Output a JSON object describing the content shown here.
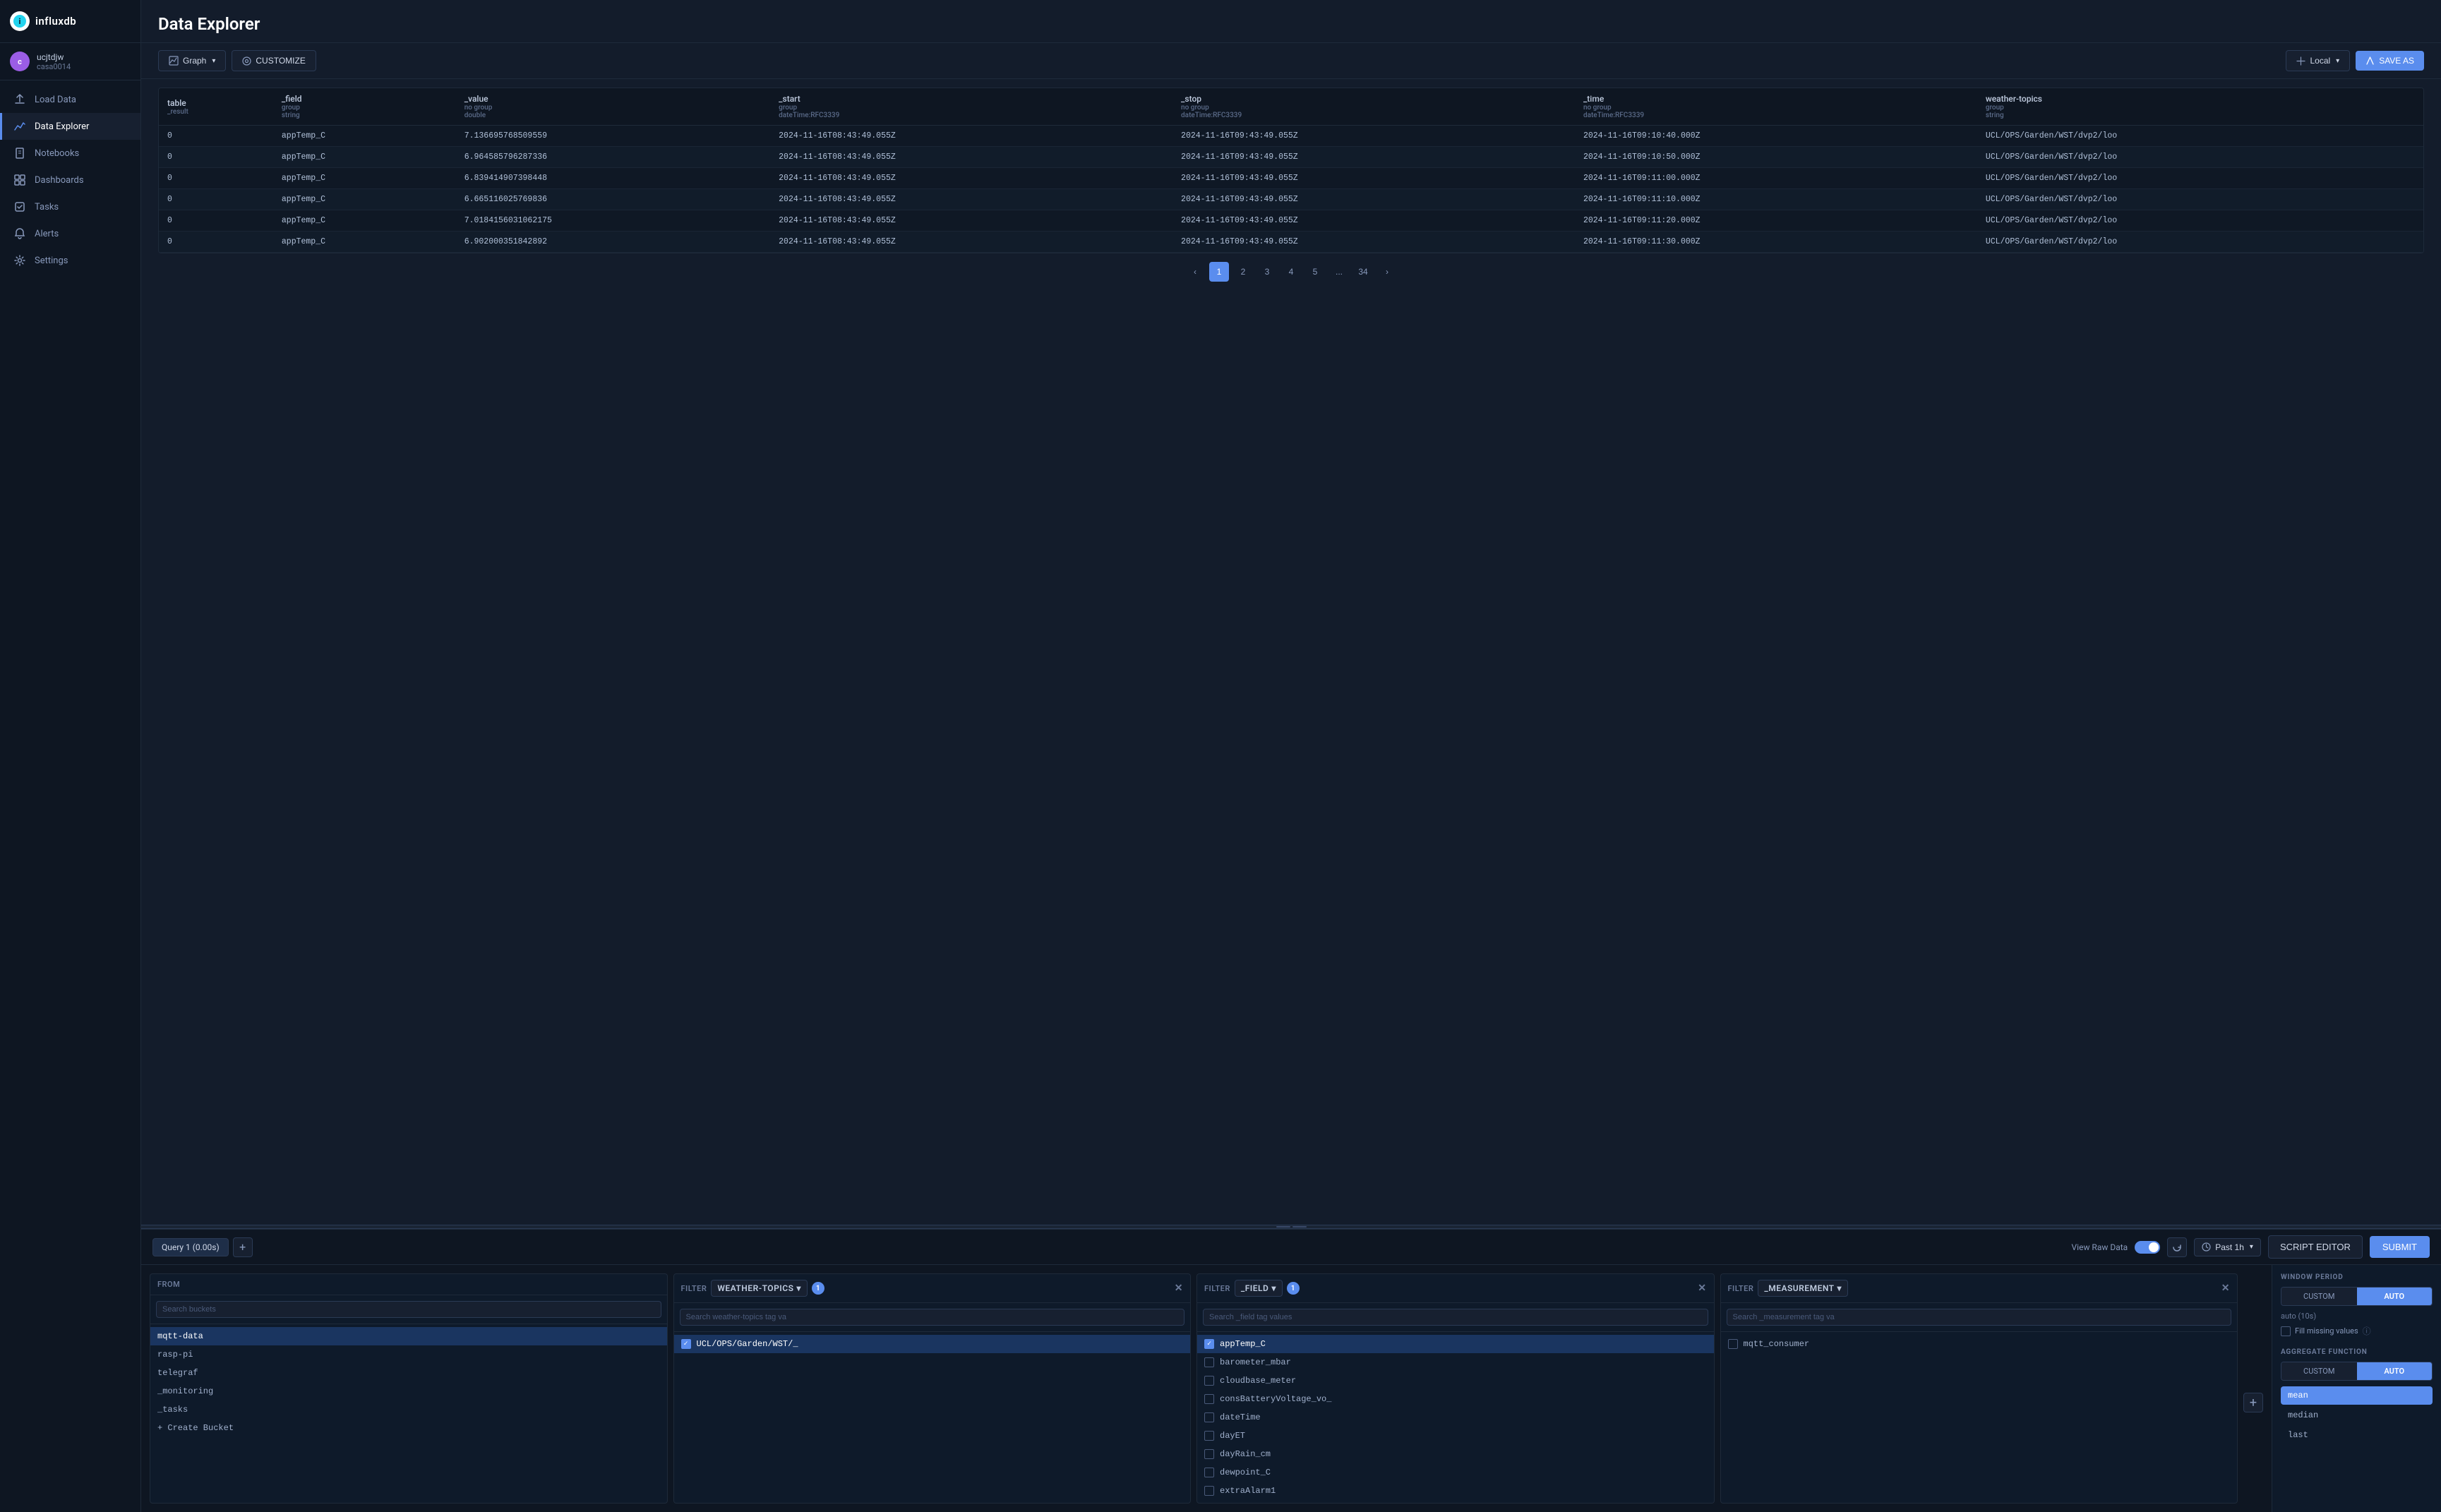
{
  "app": {
    "logo_text": "influxdb",
    "logo_initials": "i"
  },
  "sidebar": {
    "user": {
      "avatar": "c",
      "name": "ucjtdjw",
      "org": "casa0014"
    },
    "nav_items": [
      {
        "id": "load-data",
        "label": "Load Data",
        "icon": "↑"
      },
      {
        "id": "data-explorer",
        "label": "Data Explorer",
        "icon": "📈",
        "active": true
      },
      {
        "id": "notebooks",
        "label": "Notebooks",
        "icon": "📓"
      },
      {
        "id": "dashboards",
        "label": "Dashboards",
        "icon": "⊞"
      },
      {
        "id": "tasks",
        "label": "Tasks",
        "icon": "✓"
      },
      {
        "id": "alerts",
        "label": "Alerts",
        "icon": "🔔"
      },
      {
        "id": "settings",
        "label": "Settings",
        "icon": "⚙"
      }
    ]
  },
  "page": {
    "title": "Data Explorer"
  },
  "toolbar": {
    "graph_label": "Graph",
    "customize_label": "CUSTOMIZE",
    "local_label": "Local",
    "save_label": "SAVE AS"
  },
  "table": {
    "columns": [
      {
        "main": "table",
        "sub1": "_result",
        "sub2": ""
      },
      {
        "main": "_field",
        "sub1": "group",
        "sub2": "string"
      },
      {
        "main": "_value",
        "sub1": "no group",
        "sub2": "double"
      },
      {
        "main": "_start",
        "sub1": "group",
        "sub2": "dateTime:RFC3339"
      },
      {
        "main": "_stop",
        "sub1": "no group",
        "sub2": "dateTime:RFC3339"
      },
      {
        "main": "_time",
        "sub1": "no group",
        "sub2": "dateTime:RFC3339"
      },
      {
        "main": "weather-topics",
        "sub1": "group",
        "sub2": "string"
      }
    ],
    "rows": [
      {
        "table": "0",
        "field": "appTemp_C",
        "value": "7.136695768509559",
        "start": "2024-11-16T08:43:49.055Z",
        "stop": "2024-11-16T09:43:49.055Z",
        "time": "2024-11-16T09:10:40.000Z",
        "topic": "UCL/OPS/Garden/WST/dvp2/loo"
      },
      {
        "table": "0",
        "field": "appTemp_C",
        "value": "6.964585796287336",
        "start": "2024-11-16T08:43:49.055Z",
        "stop": "2024-11-16T09:43:49.055Z",
        "time": "2024-11-16T09:10:50.000Z",
        "topic": "UCL/OPS/Garden/WST/dvp2/loo"
      },
      {
        "table": "0",
        "field": "appTemp_C",
        "value": "6.839414907398448",
        "start": "2024-11-16T08:43:49.055Z",
        "stop": "2024-11-16T09:43:49.055Z",
        "time": "2024-11-16T09:11:00.000Z",
        "topic": "UCL/OPS/Garden/WST/dvp2/loo"
      },
      {
        "table": "0",
        "field": "appTemp_C",
        "value": "6.665116025769836",
        "start": "2024-11-16T08:43:49.055Z",
        "stop": "2024-11-16T09:43:49.055Z",
        "time": "2024-11-16T09:11:10.000Z",
        "topic": "UCL/OPS/Garden/WST/dvp2/loo"
      },
      {
        "table": "0",
        "field": "appTemp_C",
        "value": "7.0184156031062175",
        "start": "2024-11-16T08:43:49.055Z",
        "stop": "2024-11-16T09:43:49.055Z",
        "time": "2024-11-16T09:11:20.000Z",
        "topic": "UCL/OPS/Garden/WST/dvp2/loo"
      },
      {
        "table": "0",
        "field": "appTemp_C",
        "value": "6.902000351842892",
        "start": "2024-11-16T08:43:49.055Z",
        "stop": "2024-11-16T09:43:49.055Z",
        "time": "2024-11-16T09:11:30.000Z",
        "topic": "UCL/OPS/Garden/WST/dvp2/loo"
      }
    ]
  },
  "pagination": {
    "pages": [
      "1",
      "2",
      "3",
      "4",
      "5",
      "...",
      "34"
    ],
    "current": "1",
    "prev_label": "‹",
    "next_label": "›"
  },
  "query": {
    "tabs": [
      {
        "label": "Query 1 (0.00s)",
        "active": true
      }
    ],
    "view_raw_label": "View Raw Data",
    "time_range": "Past 1h",
    "script_editor_label": "SCRIPT EDITOR",
    "submit_label": "SUBMIT"
  },
  "from_panel": {
    "header": "FROM",
    "search_placeholder": "Search buckets",
    "buckets": [
      {
        "name": "mqtt-data",
        "selected": true
      },
      {
        "name": "rasp-pi",
        "selected": false
      },
      {
        "name": "telegraf",
        "selected": false
      },
      {
        "name": "_monitoring",
        "selected": false
      },
      {
        "name": "_tasks",
        "selected": false
      },
      {
        "name": "+ Create Bucket",
        "selected": false
      }
    ]
  },
  "filter1": {
    "header": "Filter",
    "dropdown_value": "weather-topics",
    "badge_count": "1",
    "search_placeholder": "Search weather-topics tag va",
    "items": [
      {
        "value": "UCL/OPS/Garden/WST/_",
        "checked": true
      }
    ]
  },
  "filter2": {
    "header": "Filter",
    "dropdown_value": "_field",
    "badge_count": "1",
    "search_placeholder": "Search _field tag values",
    "items": [
      {
        "value": "appTemp_C",
        "checked": true
      },
      {
        "value": "barometer_mbar",
        "checked": false
      },
      {
        "value": "cloudbase_meter",
        "checked": false
      },
      {
        "value": "consBatteryVoltage_vo_",
        "checked": false
      },
      {
        "value": "dateTime",
        "checked": false
      },
      {
        "value": "dayET",
        "checked": false
      },
      {
        "value": "dayRain_cm",
        "checked": false
      },
      {
        "value": "dewpoint_C",
        "checked": false
      },
      {
        "value": "extraAlarm1",
        "checked": false
      }
    ]
  },
  "filter3": {
    "header": "Filter",
    "dropdown_value": "_measurement",
    "search_placeholder": "Search _measurement tag va",
    "items": [
      {
        "value": "mqtt_consumer",
        "checked": false
      }
    ]
  },
  "settings": {
    "window_period_title": "WINDOW PERIOD",
    "custom_label": "CUSTOM",
    "auto_label": "AUTO",
    "auto_value": "auto (10s)",
    "fill_missing_label": "Fill missing values",
    "aggregate_function_title": "AGGREGATE FUNCTION",
    "agg_functions": [
      {
        "name": "mean",
        "active": true
      },
      {
        "name": "median",
        "active": false
      },
      {
        "name": "last",
        "active": false
      }
    ]
  }
}
